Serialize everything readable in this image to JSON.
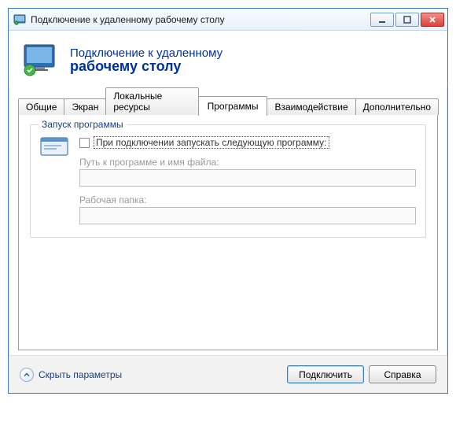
{
  "window": {
    "title": "Подключение к удаленному рабочему столу"
  },
  "header": {
    "line1": "Подключение к удаленному",
    "line2": "рабочему столу"
  },
  "tabs": {
    "general": "Общие",
    "display": "Экран",
    "local": "Локальные ресурсы",
    "programs": "Программы",
    "experience": "Взаимодействие",
    "advanced": "Дополнительно"
  },
  "programs_tab": {
    "group_title": "Запуск программы",
    "checkbox_label": "При подключении запускать следующую программу:",
    "path_label": "Путь к программе и имя файла:",
    "path_value": "",
    "folder_label": "Рабочая папка:",
    "folder_value": ""
  },
  "footer": {
    "toggle": "Скрыть параметры",
    "connect": "Подключить",
    "help": "Справка"
  }
}
